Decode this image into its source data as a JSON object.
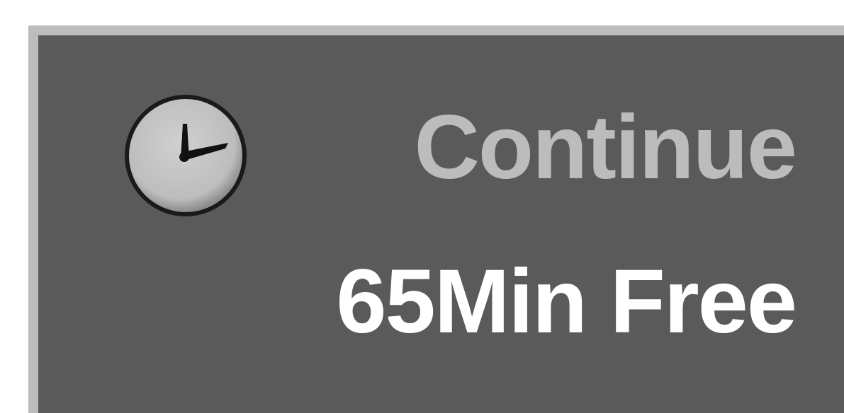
{
  "osd": {
    "status_text": "Continue",
    "remaining_text": "65Min Free",
    "icon": "clock-icon"
  },
  "colors": {
    "panel_background": "#5a5a5a",
    "panel_border": "#bdbdbd",
    "status_text": "#bcbcbc",
    "remaining_text": "#ffffff",
    "clock_face": "#bdbdbd"
  }
}
